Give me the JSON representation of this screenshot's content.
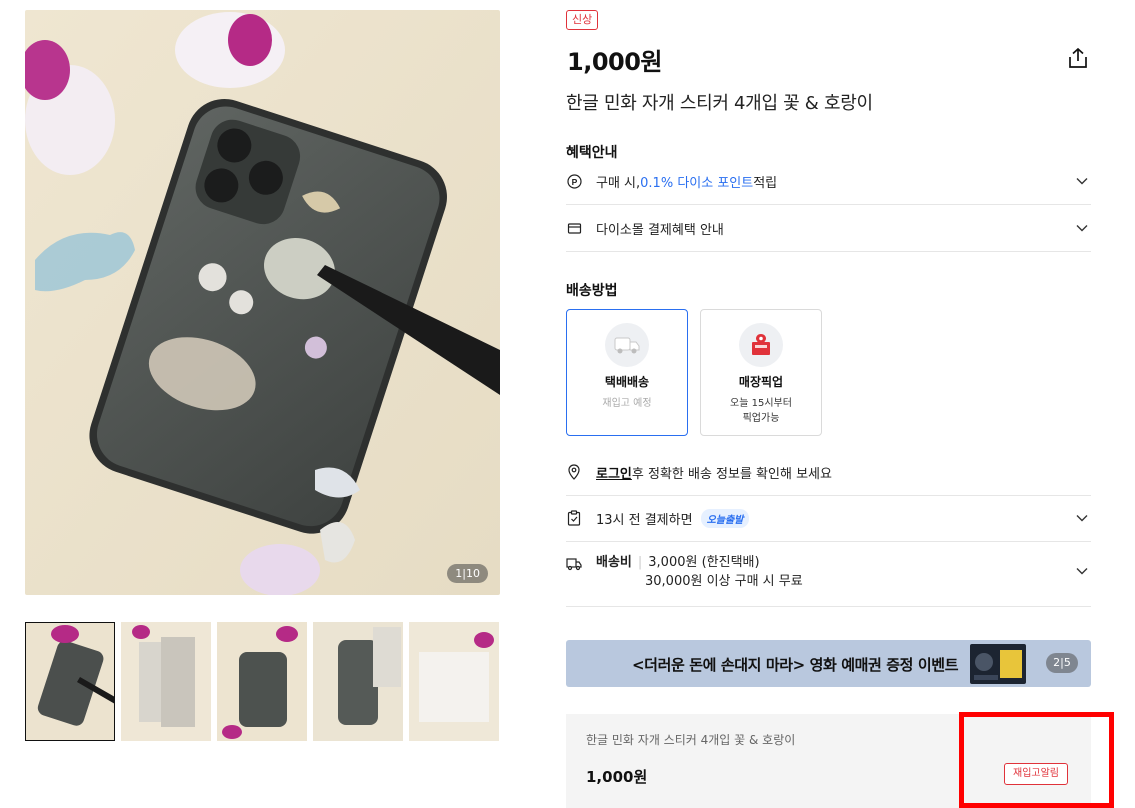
{
  "gallery": {
    "counter": "1|10",
    "thumbnails": [
      "thumb-1",
      "thumb-2",
      "thumb-3",
      "thumb-4",
      "thumb-5"
    ]
  },
  "product": {
    "badge": "신상",
    "price": "1,000원",
    "title": "한글 민화 자개 스티커 4개입 꽃 & 호랑이"
  },
  "benefits": {
    "heading": "혜택안내",
    "point_prefix": "구매 시, ",
    "point_highlight": "0.1% 다이소 포인트",
    "point_suffix": " 적립",
    "payment": "다이소몰 결제혜택 안내"
  },
  "delivery": {
    "heading": "배송방법",
    "options": [
      {
        "name": "택배배송",
        "sub": "재입고 예정",
        "selected": true
      },
      {
        "name": "매장픽업",
        "sub_line1": "오늘 15시부터",
        "sub_line2": "픽업가능",
        "selected": false
      }
    ],
    "login_link": "로그인",
    "login_text": " 후 정확한 배송 정보를 확인해 보세요",
    "cutoff_text": "13시 전 결제하면",
    "today_badge": "오늘출발",
    "fee_label": "배송비",
    "fee_value": "3,000원 (한진택배)",
    "fee_free": "30,000원 이상 구매 시 무료"
  },
  "banner": {
    "text": "<더러운 돈에 손대지 마라> 영화 예매권 증정 이벤트",
    "counter": "2|5"
  },
  "summary": {
    "name": "한글 민화 자개 스티커 4개입 꽃 & 호랑이",
    "price": "1,000원",
    "restock_button": "재입고알림"
  },
  "colors": {
    "accent_red": "#e0323a",
    "accent_blue": "#2a6ff0",
    "banner_bg": "#b9c8de",
    "highlight": "#ff0000"
  }
}
